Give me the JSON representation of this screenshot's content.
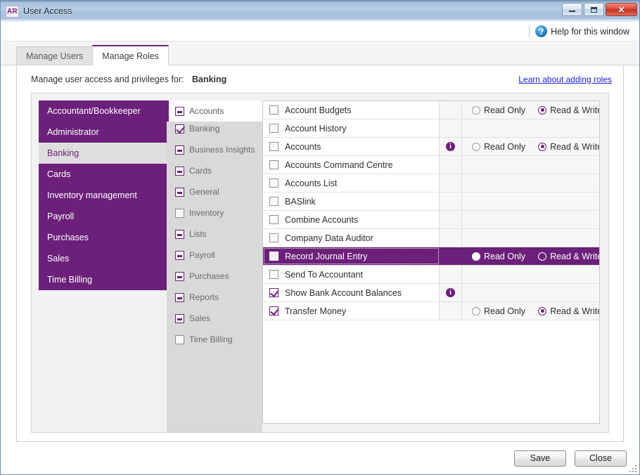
{
  "window": {
    "app_badge": "AR",
    "title": "User Access",
    "minimize_label": "Minimize",
    "maximize_label": "Maximize",
    "close_label": "✕"
  },
  "help": {
    "icon": "question-mark-icon",
    "label": "Help for this window"
  },
  "tabs": [
    {
      "label": "Manage Users",
      "active": false
    },
    {
      "label": "Manage Roles",
      "active": true
    }
  ],
  "panel": {
    "heading_prefix": "Manage user access and privileges for:",
    "context": "Banking",
    "learn_link": "Learn about adding roles"
  },
  "roles": {
    "items": [
      {
        "label": "Accountant/Bookkeeper",
        "selected": false
      },
      {
        "label": "Administrator",
        "selected": false
      },
      {
        "label": "Banking",
        "selected": true
      },
      {
        "label": "Cards",
        "selected": false
      },
      {
        "label": "Inventory management",
        "selected": false
      },
      {
        "label": "Payroll",
        "selected": false
      },
      {
        "label": "Purchases",
        "selected": false
      },
      {
        "label": "Sales",
        "selected": false
      },
      {
        "label": "Time Billing",
        "selected": false
      }
    ]
  },
  "categories": {
    "items": [
      {
        "label": "Accounts",
        "state": "partial",
        "selected": true
      },
      {
        "label": "Banking",
        "state": "checked",
        "selected": false
      },
      {
        "label": "Business Insights",
        "state": "partial",
        "selected": false
      },
      {
        "label": "Cards",
        "state": "partial",
        "selected": false
      },
      {
        "label": "General",
        "state": "partial",
        "selected": false
      },
      {
        "label": "Inventory",
        "state": "unchecked",
        "selected": false
      },
      {
        "label": "Lists",
        "state": "partial",
        "selected": false
      },
      {
        "label": "Payroll",
        "state": "partial",
        "selected": false
      },
      {
        "label": "Purchases",
        "state": "partial",
        "selected": false
      },
      {
        "label": "Reports",
        "state": "partial",
        "selected": false
      },
      {
        "label": "Sales",
        "state": "partial",
        "selected": false
      },
      {
        "label": "Time Billing",
        "state": "unchecked",
        "selected": false
      }
    ]
  },
  "permissions": {
    "read_only_label": "Read Only",
    "read_write_label": "Read & Write",
    "info_icon": "info-icon"
  },
  "features": {
    "rows": [
      {
        "label": "Account Budgets",
        "state": "unchecked",
        "info": false,
        "perm": "read_write",
        "selected": false
      },
      {
        "label": "Account History",
        "state": "unchecked",
        "info": false,
        "perm": "none",
        "selected": false
      },
      {
        "label": "Accounts",
        "state": "unchecked",
        "info": true,
        "perm": "read_write",
        "selected": false
      },
      {
        "label": "Accounts Command Centre",
        "state": "unchecked",
        "info": false,
        "perm": "none",
        "selected": false
      },
      {
        "label": "Accounts List",
        "state": "unchecked",
        "info": false,
        "perm": "none",
        "selected": false
      },
      {
        "label": "BASlink",
        "state": "unchecked",
        "info": false,
        "perm": "none",
        "selected": false
      },
      {
        "label": "Combine Accounts",
        "state": "unchecked",
        "info": false,
        "perm": "none",
        "selected": false
      },
      {
        "label": "Company Data Auditor",
        "state": "unchecked",
        "info": false,
        "perm": "none",
        "selected": false
      },
      {
        "label": "Record Journal Entry",
        "state": "unchecked",
        "info": false,
        "perm": "read_only",
        "selected": true
      },
      {
        "label": "Send To Accountant",
        "state": "unchecked",
        "info": false,
        "perm": "none",
        "selected": false
      },
      {
        "label": "Show Bank Account Balances",
        "state": "checked",
        "info": true,
        "perm": "none",
        "selected": false
      },
      {
        "label": "Transfer Money",
        "state": "checked",
        "info": false,
        "perm": "read_write",
        "selected": false
      }
    ]
  },
  "footer": {
    "save_label": "Save",
    "close_label": "Close"
  },
  "colors": {
    "brand_purple": "#6c2079",
    "link_blue": "#1b23d4",
    "selected_role_bg": "#dedede",
    "close_red": "#c23426"
  }
}
